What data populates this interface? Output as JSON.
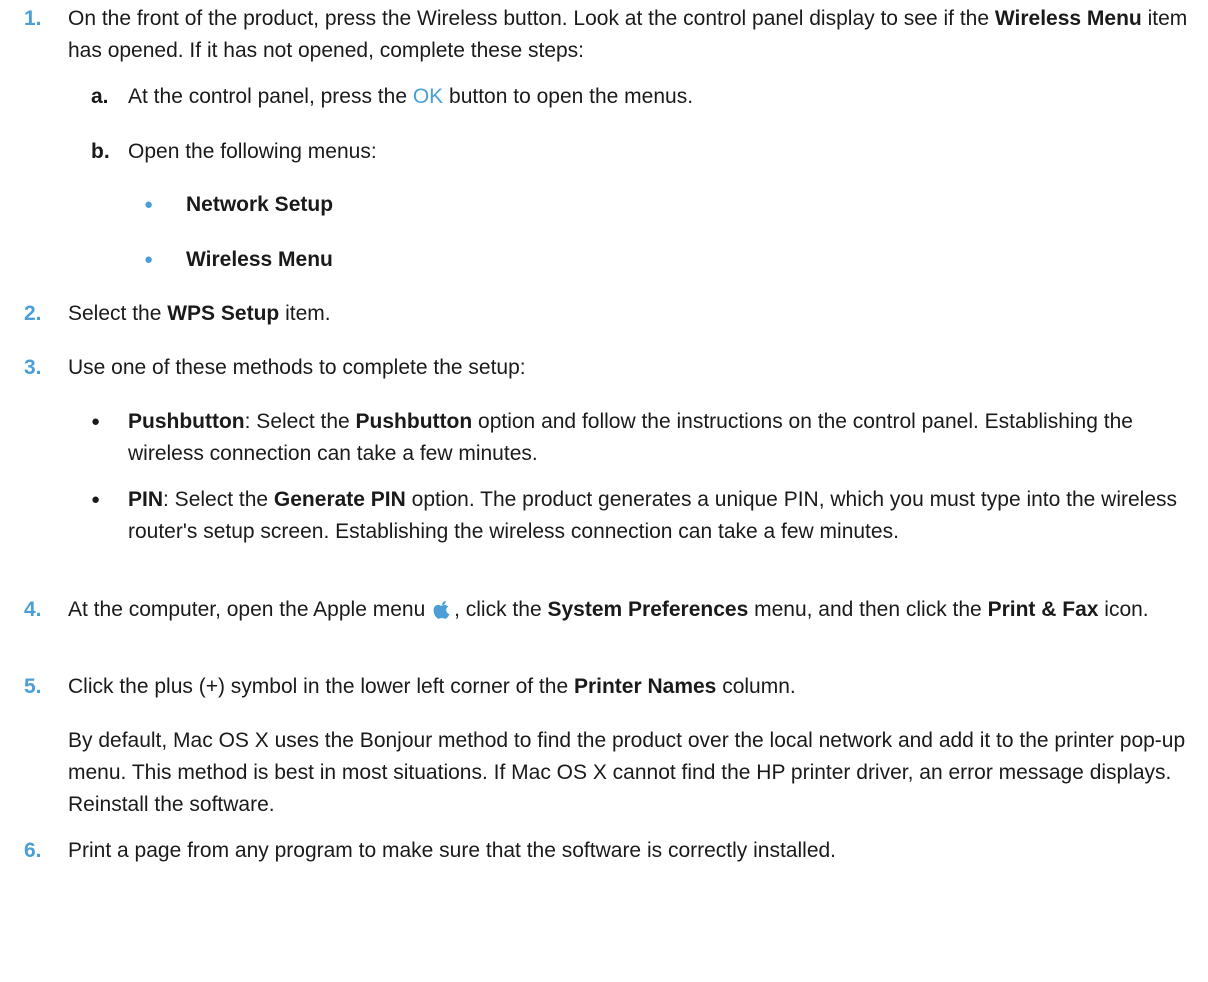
{
  "steps": {
    "s1": {
      "num": "1.",
      "pre": "On the front of the product, press the Wireless button. Look at the control panel display to see if the ",
      "bold1": "Wireless Menu",
      "post": " item has opened. If it has not opened, complete these steps:"
    },
    "s1a": {
      "letter": "a.",
      "pre": "At the control panel, press the ",
      "ok": "OK",
      "post": " button to open the menus."
    },
    "s1b": {
      "letter": "b.",
      "text": "Open the following menus:"
    },
    "s1b_items": [
      "Network Setup",
      "Wireless Menu"
    ],
    "s2": {
      "num": "2.",
      "pre": "Select the ",
      "bold1": "WPS Setup",
      "post": " item."
    },
    "s3": {
      "num": "3.",
      "text": "Use one of these methods to complete the setup:"
    },
    "s3_push": {
      "bold1": "Pushbutton",
      "mid": ": Select the ",
      "bold2": "Pushbutton",
      "post": " option and follow the instructions on the control panel. Establishing the wireless connection can take a few minutes."
    },
    "s3_pin": {
      "bold1": "PIN",
      "mid": ": Select the ",
      "bold2": "Generate PIN",
      "post": " option. The product generates a unique PIN, which you must type into the wireless router's setup screen. Establishing the wireless connection can take a few minutes."
    },
    "s4": {
      "num": "4.",
      "pre": "At the computer, open the Apple menu ",
      "mid1": ", click the ",
      "bold1": "System Preferences",
      "mid2": " menu, and then click the ",
      "bold2": "Print & Fax",
      "post": " icon."
    },
    "s5": {
      "num": "5.",
      "pre": "Click the plus (+) symbol in the lower left corner of the ",
      "bold1": "Printer Names",
      "post": " column.",
      "para": "By default, Mac OS X uses the Bonjour method to find the product over the local network and add it to the printer pop-up menu. This method is best in most situations. If Mac OS X cannot find the HP printer driver, an error message displays. Reinstall the software."
    },
    "s6": {
      "num": "6.",
      "text": "Print a page from any program to make sure that the software is correctly installed."
    }
  },
  "colors": {
    "accent": "#4b9fd6",
    "text": "#1a1a1a"
  },
  "icons": {
    "apple": "apple-logo-icon"
  }
}
